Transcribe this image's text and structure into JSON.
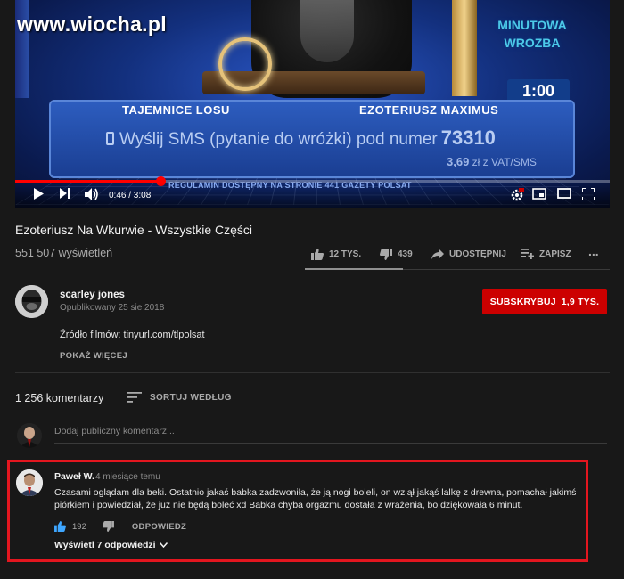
{
  "watermark": "www.wiocha.pl",
  "video_overlay": {
    "minutowa_line1": "MINUTOWA",
    "minutowa_line2": "WROZBA",
    "timer": "1:00",
    "panel_left": "TAJEMNICE LOSU",
    "panel_right": "EZOTERIUSZ MAXIMUS",
    "sms_text": "Wyślij SMS (pytanie do wróżki) pod numer",
    "sms_number": "73310",
    "price_value": "3,69",
    "price_unit": "zł z VAT/SMS",
    "regulamin": "REGULAMIN DOSTĘPNY NA STRONIE 441 GAZETY POLSAT"
  },
  "player": {
    "current_time": "0:46",
    "duration": "3:08",
    "time_display": "0:46 / 3:08",
    "progress_fraction": 0.245,
    "accent_color": "#ff0000",
    "icons": [
      "play-icon",
      "next-icon",
      "volume-icon",
      "settings-icon",
      "miniplayer-icon",
      "theater-icon",
      "fullscreen-icon"
    ]
  },
  "video": {
    "title": "Ezoteriusz Na Wkurwie - Wszystkie Części",
    "views": "551 507 wyświetleń"
  },
  "actions": {
    "likes": "12 TYS.",
    "dislikes": "439",
    "share": "UDOSTĘPNIJ",
    "save": "ZAPISZ",
    "more": "..."
  },
  "channel": {
    "name": "scarley jones",
    "published": "Opublikowany 25 sie 2018",
    "subscribe_label": "SUBSKRYBUJ",
    "subscriber_count": "1,9 TYS.",
    "subscribe_color": "#cc0000"
  },
  "description": {
    "text": "Źródło filmów: tinyurl.com/tlpolsat",
    "show_more": "POKAŻ WIĘCEJ"
  },
  "comments": {
    "count": "1 256 komentarzy",
    "sort_label": "SORTUJ WEDŁUG",
    "add_placeholder": "Dodaj publiczny komentarz...",
    "items": [
      {
        "author": "Paweł W.",
        "time": "4 miesiące temu",
        "text": "Czasami oglądam dla beki. Ostatnio jakaś babka zadzwoniła, że ją nogi boleli, on wziął jakąś lalkę z drewna, pomachał jakimś piórkiem i powiedział, że już nie będą boleć xd Babka chyba orgazmu dostała z wrażenia, bo dziękowała 6 minut.",
        "likes": "192",
        "reply_label": "ODPOWIEDZ",
        "view_replies": "Wyświetl 7 odpowiedzi"
      }
    ],
    "highlight_color": "#e3161f"
  }
}
